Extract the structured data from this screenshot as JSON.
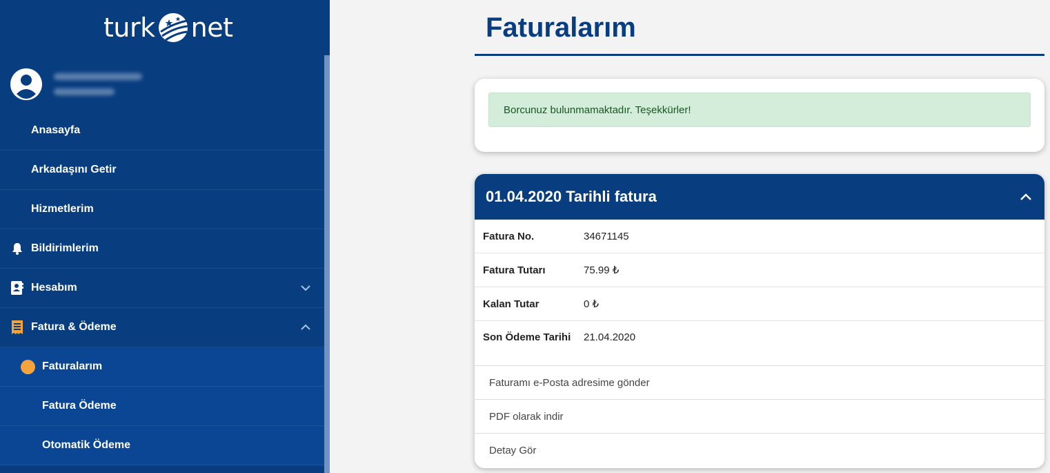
{
  "brand": {
    "left": "turk",
    "right": "net"
  },
  "sidebar": {
    "items": [
      {
        "label": "Anasayfa"
      },
      {
        "label": "Arkadaşını Getir"
      },
      {
        "label": "Hizmetlerim"
      },
      {
        "label": "Bildirimlerim",
        "icon": "bell-icon"
      },
      {
        "label": "Hesabım",
        "icon": "account-card-icon"
      },
      {
        "label": "Fatura & Ödeme",
        "icon": "receipt-icon"
      },
      {
        "label": "Faturalarım"
      },
      {
        "label": "Fatura Ödeme"
      },
      {
        "label": "Otomatik Ödeme"
      }
    ]
  },
  "main": {
    "title": "Faturalarım",
    "alert": "Borcunuz bulunmamaktadır. Teşekkürler!",
    "invoice": {
      "header": "01.04.2020 Tarihli fatura",
      "rows": [
        {
          "key": "Fatura No.",
          "value": "34671145"
        },
        {
          "key": "Fatura Tutarı",
          "value": "75.99 ₺"
        },
        {
          "key": "Kalan Tutar",
          "value": "0 ₺"
        },
        {
          "key": "Son Ödeme Tarihi",
          "value": "21.04.2020"
        }
      ],
      "actions": [
        {
          "label": "Faturamı e-Posta adresime gönder"
        },
        {
          "label": "PDF olarak indir"
        },
        {
          "label": "Detay Gör"
        }
      ]
    }
  },
  "colors": {
    "navy": "#083d80",
    "active": "#0c52b0",
    "accent": "#f7a33c",
    "alert_bg": "#d4edda"
  }
}
